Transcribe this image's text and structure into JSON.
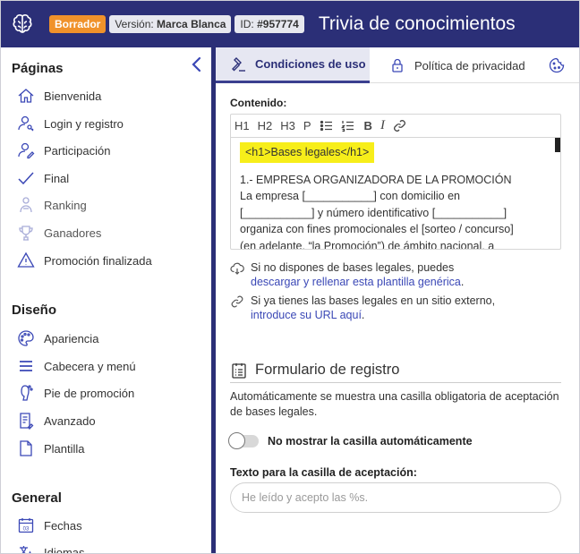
{
  "header": {
    "draft_badge": "Borrador",
    "version_label": "Versión:",
    "version_value": "Marca Blanca",
    "id_label": "ID:",
    "id_value": "#957774",
    "title": "Trivia de conocimientos",
    "brand_color": "#2b2f77",
    "draft_color": "#f0922b"
  },
  "sidebar": {
    "sections": [
      {
        "title": "Páginas"
      },
      {
        "title": "Diseño"
      },
      {
        "title": "General"
      }
    ],
    "pages": [
      {
        "label": "Bienvenida",
        "icon": "home-icon"
      },
      {
        "label": "Login y registro",
        "icon": "user-key-icon"
      },
      {
        "label": "Participación",
        "icon": "user-edit-icon"
      },
      {
        "label": "Final",
        "icon": "check-icon"
      },
      {
        "label": "Ranking",
        "icon": "ranking-icon"
      },
      {
        "label": "Ganadores",
        "icon": "trophy-icon"
      },
      {
        "label": "Promoción finalizada",
        "icon": "warning-icon"
      }
    ],
    "design": [
      {
        "label": "Apariencia",
        "icon": "palette-icon"
      },
      {
        "label": "Cabecera y menú",
        "icon": "menu-icon"
      },
      {
        "label": "Pie de promoción",
        "icon": "footer-icon"
      },
      {
        "label": "Avanzado",
        "icon": "advanced-icon"
      },
      {
        "label": "Plantilla",
        "icon": "template-icon"
      }
    ],
    "general": [
      {
        "label": "Fechas",
        "icon": "calendar-icon",
        "calendar_day": "03"
      },
      {
        "label": "Idiomas",
        "icon": "language-icon"
      }
    ]
  },
  "tabs": [
    {
      "label": "Condiciones de uso",
      "icon": "gavel-icon",
      "active": true
    },
    {
      "label": "Política de privacidad",
      "icon": "lock-icon",
      "active": false
    },
    {
      "label": "",
      "icon": "cookie-icon",
      "active": false
    }
  ],
  "content": {
    "label": "Contenido:",
    "toolbar": [
      "H1",
      "H2",
      "H3",
      "P"
    ],
    "toolbar_icons": [
      "bullet-list-icon",
      "numbered-list-icon",
      "bold-icon",
      "italic-icon",
      "link-icon"
    ],
    "toolbar_bold": "B",
    "toolbar_italic": "I",
    "highlight": "<h1>Bases legales</h1>",
    "lines": [
      "1.- EMPRESA ORGANIZADORA DE LA PROMOCIÓN",
      "La empresa [___________] con domicilio en",
      "[___________]  y número identificativo [___________]",
      "organiza con fines promocionales el [sorteo / concurso]",
      "(en adelante, “la Promoción”) de ámbito nacional, a"
    ]
  },
  "help": {
    "template_text": "Si no dispones de bases legales, puedes",
    "template_link": "descargar y rellenar esta plantilla genérica",
    "template_end": ".",
    "url_text": "Si ya tienes las bases legales en un sitio externo,",
    "url_link": "introduce su URL aquí",
    "url_end": "."
  },
  "form": {
    "title": "Formulario de registro",
    "description": "Automáticamente se muestra una casilla obligatoria de aceptación de bases legales.",
    "toggle_label": "No mostrar la casilla automáticamente",
    "toggle_on": false,
    "field_label": "Texto para la casilla de aceptación:",
    "field_placeholder": "He leído y acepto las %s.",
    "field_value": ""
  }
}
